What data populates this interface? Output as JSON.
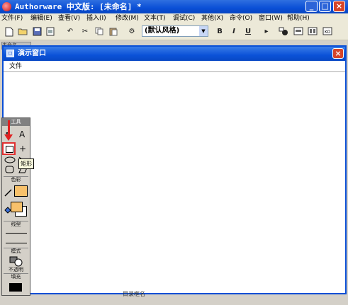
{
  "app": {
    "title": "Authorware 中文版: [未命名] *",
    "min_label": "_",
    "max_label": "□",
    "close_label": "×"
  },
  "menu": {
    "items": [
      "文件(F)",
      "编辑(E)",
      "查看(V)",
      "插入(I)",
      "修改(M)",
      "文本(T)",
      "调试(C)",
      "其他(X)",
      "命令(O)",
      "窗口(W)",
      "帮助(H)"
    ]
  },
  "toolbar": {
    "style_value": "(默认风格)",
    "bold": "B",
    "italic": "I",
    "underline": "U"
  },
  "background": {
    "tab_label": "未命名"
  },
  "presentation": {
    "title": "演示窗口",
    "close_label": "×",
    "menu_file": "文件",
    "bottom_text": "目录框名"
  },
  "tools": {
    "title": "工具",
    "text_tool": "A",
    "cross_tool": "+",
    "tooltip": "矩形",
    "color_label": "色彩",
    "line_label": "线型",
    "mode_label": "模式",
    "opacity_label": "不透明",
    "fill_label": "填充",
    "accent_color": "#f7c16b",
    "highlight_color": "#e03030"
  }
}
